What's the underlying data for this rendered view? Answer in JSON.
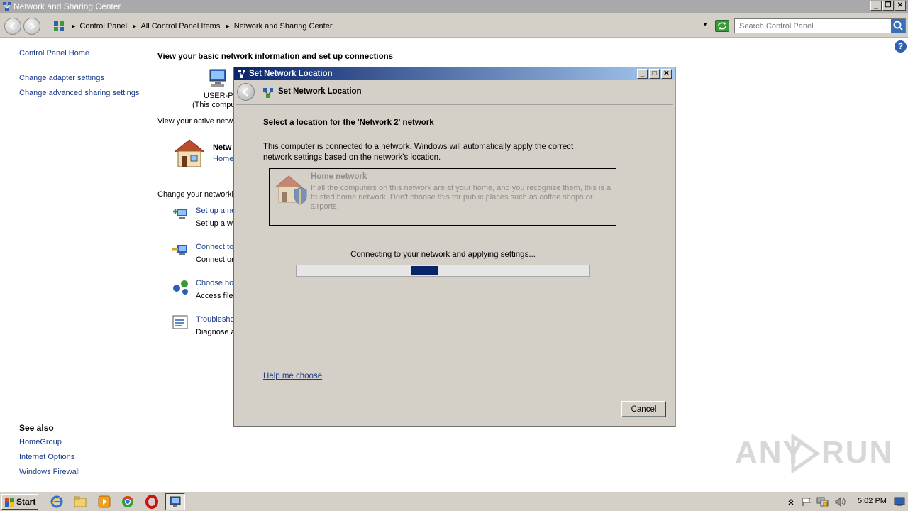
{
  "window": {
    "title": "Network and Sharing Center"
  },
  "address": {
    "crumbs": [
      "Control Panel",
      "All Control Panel Items",
      "Network and Sharing Center"
    ],
    "search_placeholder": "Search Control Panel"
  },
  "sidebar": {
    "home": "Control Panel Home",
    "links": [
      "Change adapter settings",
      "Change advanced sharing settings"
    ],
    "see_also_title": "See also",
    "see_also": [
      "HomeGroup",
      "Internet Options",
      "Windows Firewall"
    ]
  },
  "main": {
    "heading": "View your basic network information and set up connections",
    "computer_name": "USER-PC",
    "computer_sub": "(This compu",
    "active_networks": "View your active netw",
    "network_name": "Netw",
    "network_type": "Home",
    "change_settings": "Change your networki",
    "tasks": [
      {
        "title": "Set up a ne",
        "desc": "Set up a wi"
      },
      {
        "title": "Connect to",
        "desc": "Connect or"
      },
      {
        "title": "Choose ho",
        "desc": "Access files"
      },
      {
        "title": "Troublesho",
        "desc": "Diagnose a"
      }
    ]
  },
  "dialog": {
    "title": "Set Network Location",
    "header": "Set Network Location",
    "select_title": "Select a location for the 'Network  2' network",
    "intro": "This computer is connected to a network. Windows will automatically apply the correct network settings based on the network's location.",
    "option_title": "Home network",
    "option_desc": "If all the computers on this network are at your home, and you recognize them, this is a trusted home network.  Don't choose this for public places such as coffee shops or airports.",
    "progress_text": "Connecting to your network and applying settings...",
    "help_link": "Help me choose",
    "cancel": "Cancel"
  },
  "watermark": {
    "left": "ANY",
    "right": "RUN"
  },
  "taskbar": {
    "start": "Start",
    "clock": "5:02 PM"
  }
}
